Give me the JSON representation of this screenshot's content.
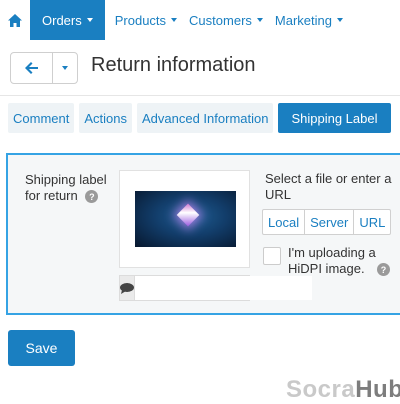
{
  "nav": {
    "home_icon": "home-icon",
    "items": [
      {
        "label": "Orders",
        "active": true
      },
      {
        "label": "Products"
      },
      {
        "label": "Customers"
      },
      {
        "label": "Marketing"
      }
    ]
  },
  "header": {
    "back_icon": "arrow-left-icon",
    "dropdown_icon": "caret-down-icon",
    "title": "Return information"
  },
  "tabs": [
    {
      "label": "Comment"
    },
    {
      "label": "Actions"
    },
    {
      "label": "Advanced Information"
    },
    {
      "label": "Shipping Label",
      "active": true
    }
  ],
  "form": {
    "label": "Shipping label for return",
    "help_icon": "question-circle-icon",
    "alt_icon": "comment-icon",
    "alt_value": "",
    "select_text": "Select a file or enter a URL",
    "sources": [
      "Local",
      "Server",
      "URL"
    ],
    "hidpi_label": "I'm uploading a HiDPI image.",
    "hidpi_checked": false
  },
  "save_label": "Save",
  "watermark": {
    "part1": "Socra",
    "part2": "Hub"
  },
  "colors": {
    "accent": "#1a7fc1",
    "panel_border": "#35a3e4",
    "tab_bg": "#eef3f6"
  }
}
